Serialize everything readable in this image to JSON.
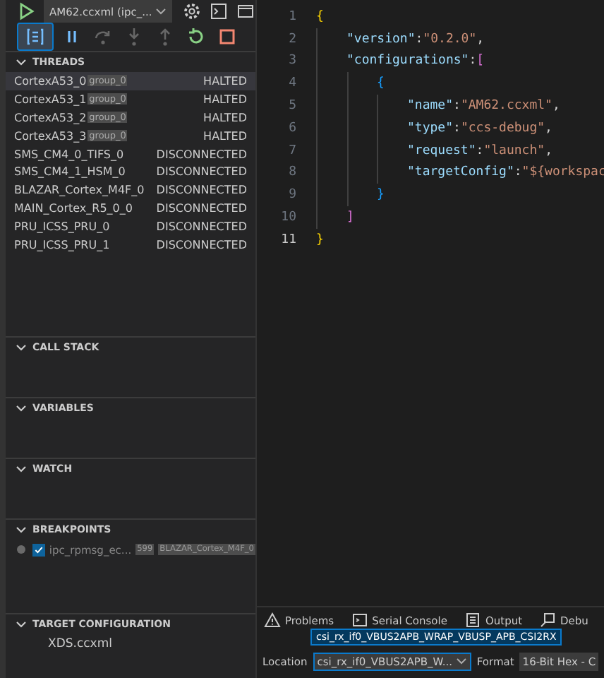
{
  "debug_toolbar": {
    "config": "AM62.ccxml (ipc_...",
    "buttons": [
      {
        "kind": "threads",
        "selected": true
      },
      {
        "kind": "pause",
        "selected": false
      },
      {
        "kind": "step-over",
        "selected": false
      },
      {
        "kind": "step-into",
        "selected": false
      },
      {
        "kind": "step-out",
        "selected": false
      },
      {
        "kind": "restart",
        "selected": false
      },
      {
        "kind": "stop",
        "selected": false
      }
    ]
  },
  "sections": [
    {
      "title": "THREADS",
      "kind": "threads",
      "rows": [
        {
          "name": "CortexA53_0",
          "group": "group_0",
          "status": "HALTED",
          "selected": true
        },
        {
          "name": "CortexA53_1",
          "group": "group_0",
          "status": "HALTED",
          "selected": false
        },
        {
          "name": "CortexA53_2",
          "group": "group_0",
          "status": "HALTED",
          "selected": false
        },
        {
          "name": "CortexA53_3",
          "group": "group_0",
          "status": "HALTED",
          "selected": false
        },
        {
          "name": "SMS_CM4_0_TIFS_0",
          "status": "DISCONNECTED",
          "selected": false
        },
        {
          "name": "SMS_CM4_1_HSM_0",
          "status": "DISCONNECTED",
          "selected": false
        },
        {
          "name": "BLAZAR_Cortex_M4F_0",
          "status": "DISCONNECTED",
          "selected": false
        },
        {
          "name": "MAIN_Cortex_R5_0_0",
          "status": "DISCONNECTED",
          "selected": false
        },
        {
          "name": "PRU_ICSS_PRU_0",
          "status": "DISCONNECTED",
          "selected": false
        },
        {
          "name": "PRU_ICSS_PRU_1",
          "status": "DISCONNECTED",
          "selected": false
        }
      ]
    },
    {
      "title": "CALL STACK",
      "kind": "empty"
    },
    {
      "title": "VARIABLES",
      "kind": "empty"
    },
    {
      "title": "WATCH",
      "kind": "empty"
    },
    {
      "title": "BREAKPOINTS",
      "kind": "breakpoints",
      "rows": [
        {
          "name": "ipc_rpmsg_ec...",
          "line": "599",
          "core": "BLAZAR_Cortex_M4F_0",
          "checked": true
        }
      ]
    },
    {
      "title": "TARGET CONFIGURATION",
      "kind": "files",
      "rows": [
        {
          "name": "XDS.ccxml"
        }
      ]
    }
  ],
  "editor": {
    "lines": [
      {
        "number": "1",
        "current": false,
        "tokens": [
          {
            "t": "{",
            "kind": "open1"
          }
        ]
      },
      {
        "number": "2",
        "current": false,
        "tokens": [
          {
            "t": "\"version\"",
            "kind": "key"
          },
          {
            "t": ": ",
            "kind": "punct"
          },
          {
            "t": "\"0.2.0\"",
            "kind": "string"
          },
          {
            "t": ",",
            "kind": "punct"
          }
        ]
      },
      {
        "number": "3",
        "current": false,
        "tokens": [
          {
            "t": "\"configurations\"",
            "kind": "key"
          },
          {
            "t": ": ",
            "kind": "punct"
          },
          {
            "t": "[",
            "kind": "open2"
          }
        ]
      },
      {
        "number": "4",
        "current": false,
        "tokens": [
          {
            "t": "{",
            "kind": "open3"
          }
        ]
      },
      {
        "number": "5",
        "current": false,
        "tokens": [
          {
            "t": "\"name\"",
            "kind": "key"
          },
          {
            "t": ": ",
            "kind": "punct"
          },
          {
            "t": "\"AM62.ccxml\"",
            "kind": "string"
          },
          {
            "t": ",",
            "kind": "punct"
          }
        ]
      },
      {
        "number": "6",
        "current": false,
        "tokens": [
          {
            "t": "\"type\"",
            "kind": "key"
          },
          {
            "t": ": ",
            "kind": "punct"
          },
          {
            "t": "\"ccs-debug\"",
            "kind": "string"
          },
          {
            "t": ",",
            "kind": "punct"
          }
        ]
      },
      {
        "number": "7",
        "current": false,
        "tokens": [
          {
            "t": "\"request\"",
            "kind": "key"
          },
          {
            "t": ": ",
            "kind": "punct"
          },
          {
            "t": "\"launch\"",
            "kind": "string"
          },
          {
            "t": ",",
            "kind": "punct"
          }
        ]
      },
      {
        "number": "8",
        "current": false,
        "tokens": [
          {
            "t": "\"targetConfig\"",
            "kind": "key"
          },
          {
            "t": ": ",
            "kind": "punct"
          },
          {
            "t": "\"${workspac",
            "kind": "string"
          }
        ]
      },
      {
        "number": "9",
        "current": false,
        "tokens": [
          {
            "t": "}",
            "kind": "close3"
          }
        ]
      },
      {
        "number": "10",
        "current": false,
        "tokens": [
          {
            "t": "]",
            "kind": "close2"
          }
        ]
      },
      {
        "number": "11",
        "current": true,
        "tokens": [
          {
            "t": "}",
            "kind": "close1"
          }
        ]
      }
    ]
  },
  "panel": {
    "tabs": [
      {
        "label": "Problems",
        "kind": "warning"
      },
      {
        "label": "Serial Console",
        "kind": "console"
      },
      {
        "label": "Output",
        "kind": "output"
      },
      {
        "label": "Debu",
        "kind": "debug"
      }
    ],
    "location_label": "Location",
    "location_value": "csi_rx_if0_VBUS2APB_W...",
    "location_tooltip": "csi_rx_if0_VBUS2APB_WRAP_VBUSP_APB_CSI2RX",
    "format_label": "Format",
    "format_value": "16-Bit Hex - C"
  }
}
